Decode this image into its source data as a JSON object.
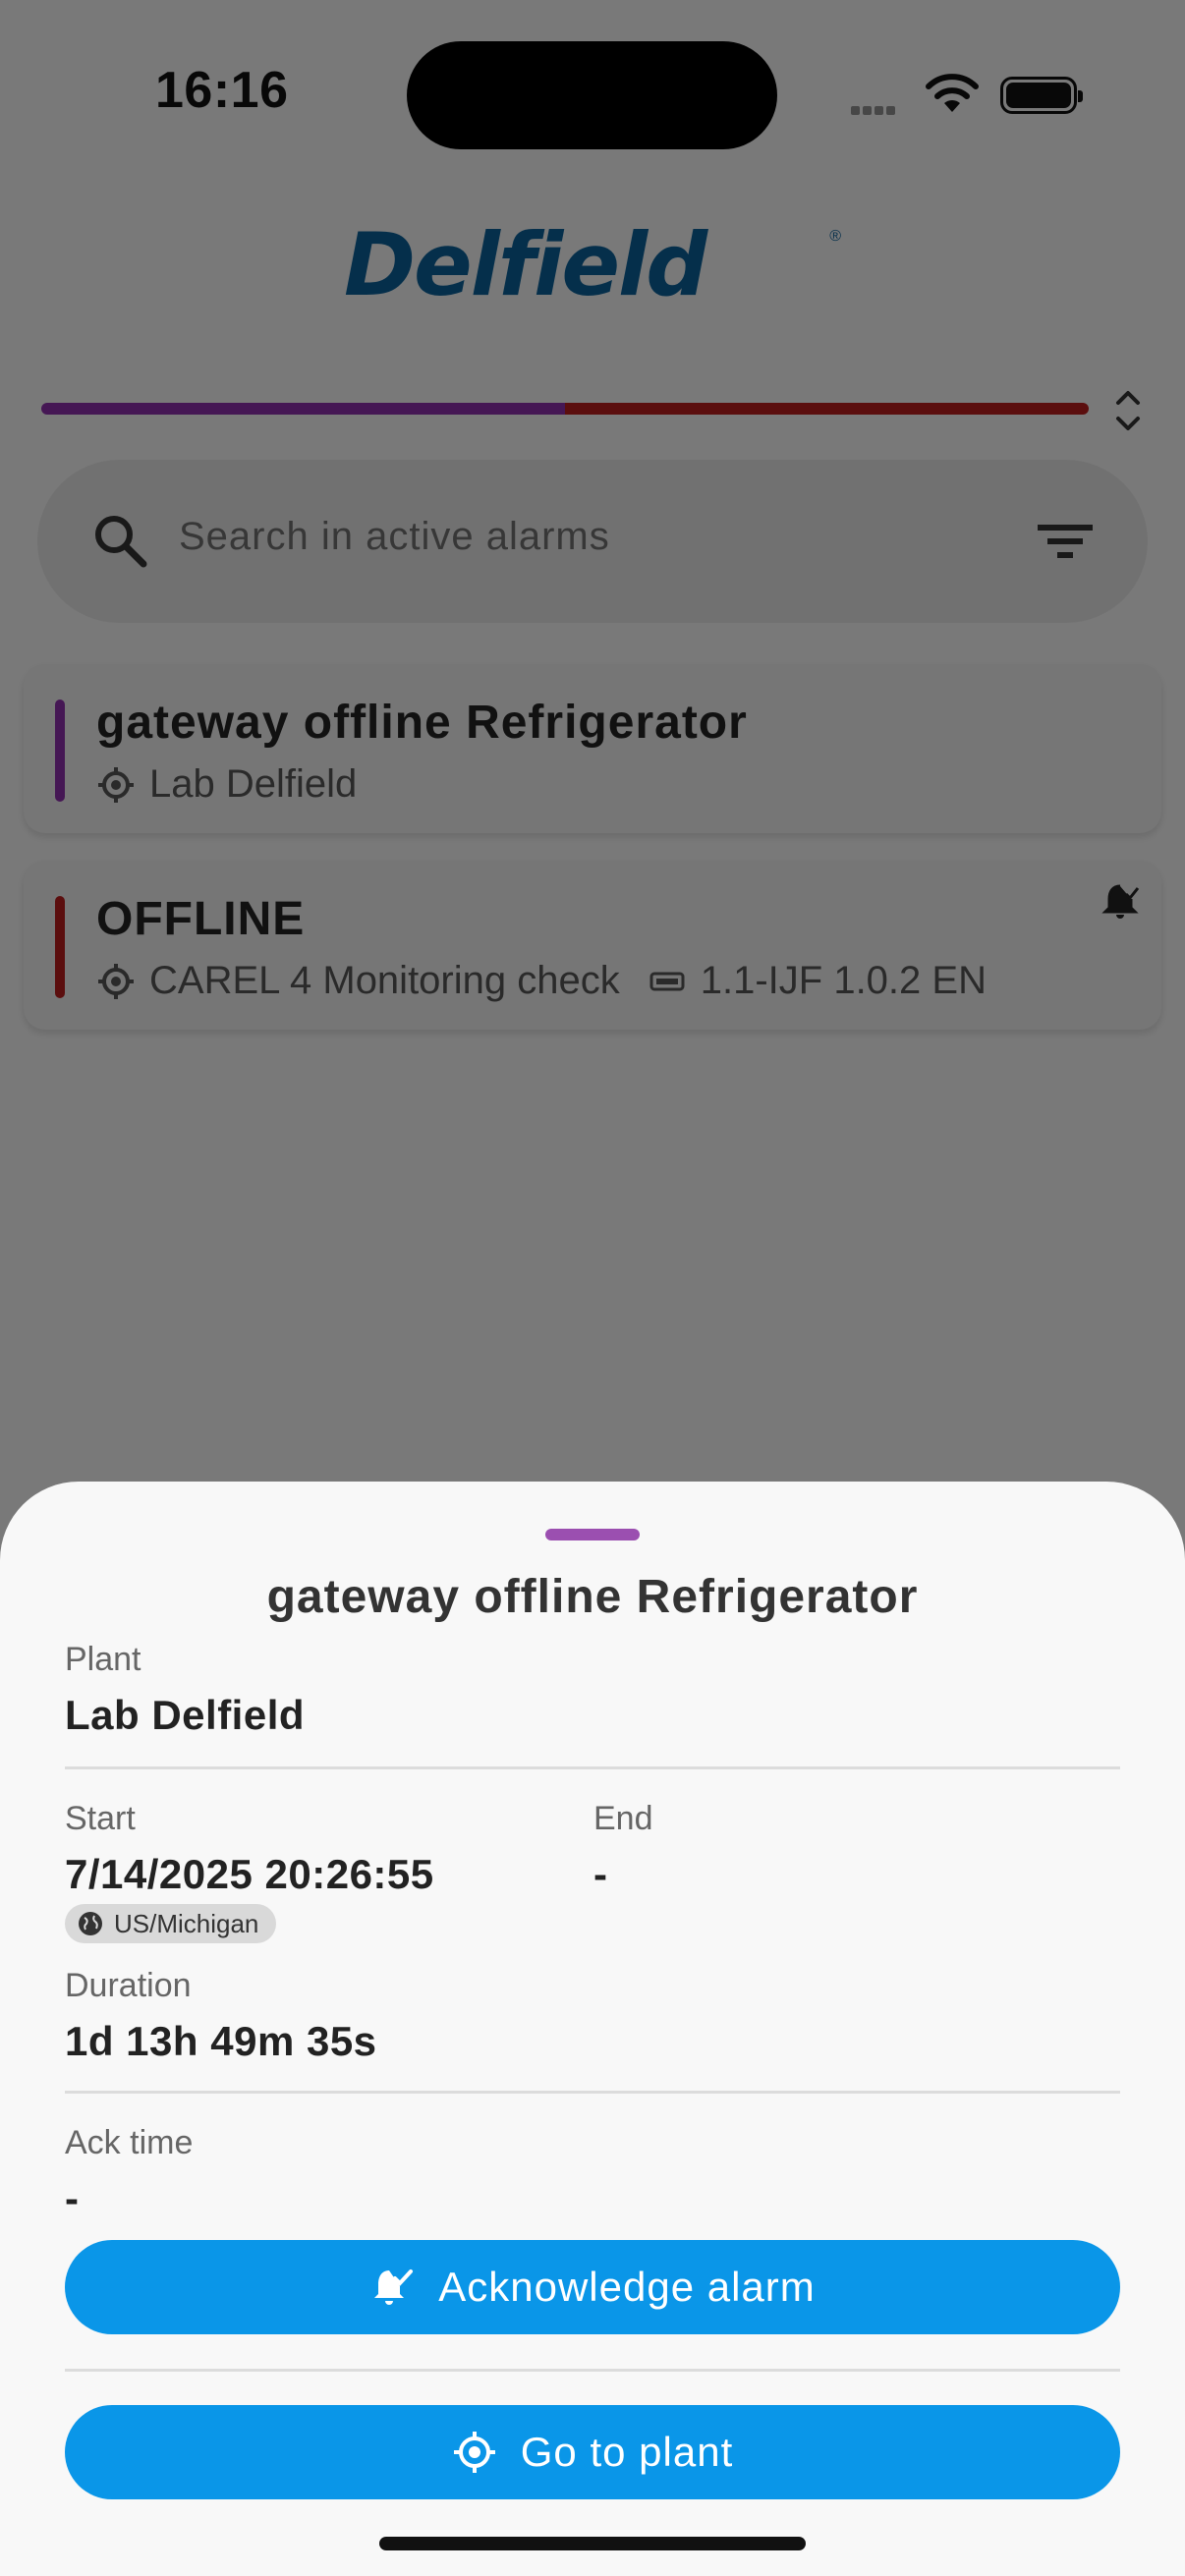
{
  "status_bar": {
    "time": "16:16"
  },
  "brand": {
    "logo_text": "Delfield",
    "logo_mark": "®",
    "color": "#0b5f97"
  },
  "alarm_summary": {
    "segments": [
      {
        "color": "#8b2fa8",
        "share": 0.5
      },
      {
        "color": "#b71c1c",
        "share": 0.5
      }
    ]
  },
  "search": {
    "placeholder": "Search in active alarms",
    "icon": "search-icon",
    "filter_icon": "filter-icon"
  },
  "alarms": [
    {
      "title": "gateway offline Refrigerator",
      "plant": "Lab Delfield",
      "device": "",
      "severity_color": "#8b2fa8",
      "acknowledged": false
    },
    {
      "title": "OFFLINE",
      "plant": "CAREL 4 Monitoring check",
      "device": "1.1-IJF 1.0.2 EN",
      "severity_color": "#b71c1c",
      "acknowledged": true
    }
  ],
  "sheet": {
    "title": "gateway offline Refrigerator",
    "handle_color": "#9b4fb0",
    "plant_label": "Plant",
    "plant_value": "Lab Delfield",
    "start_label": "Start",
    "start_value": "7/14/2025 20:26:55",
    "timezone": "US/Michigan",
    "end_label": "End",
    "end_value": "-",
    "duration_label": "Duration",
    "duration_value": "1d 13h 49m 35s",
    "ack_label": "Ack time",
    "ack_value": "-",
    "ack_button": "Acknowledge alarm",
    "goto_button": "Go to plant",
    "button_color": "#0a96e8"
  }
}
